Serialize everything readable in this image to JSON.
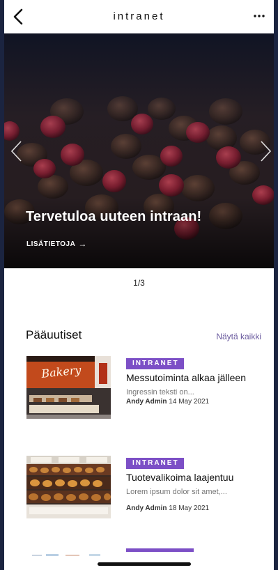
{
  "header": {
    "title": "intranet",
    "back_icon": "chevron-left-icon",
    "more_icon": "more-dots-icon"
  },
  "hero": {
    "headline": "Tervetuloa uuteen intraan!",
    "link_label": "LISÄTIETOJA",
    "link_arrow": "→",
    "pager": "1/3"
  },
  "news": {
    "section_title": "Pääuutiset",
    "show_all": "Näytä kaikki",
    "items": [
      {
        "badge": "INTRANET",
        "headline": "Messutoiminta alkaa jälleen",
        "excerpt": "Ingressin teksti on...",
        "author": "Andy Admin",
        "date": "14 May 2021",
        "thumb_sign": "Bakery"
      },
      {
        "badge": "INTRANET",
        "headline": "Tuotevalikoima laajentuu",
        "excerpt": "Lorem ipsum dolor sit amet,...",
        "author": "Andy Admin",
        "date": "18 May 2021"
      }
    ]
  },
  "colors": {
    "accent": "#7c4fc6",
    "link": "#6a5a9e",
    "frame": "#1b2440"
  }
}
